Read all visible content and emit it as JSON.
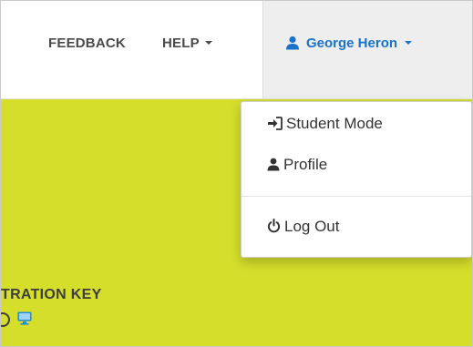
{
  "nav": {
    "feedback_label": "FEEDBACK",
    "help_label": "HELP",
    "user_name": "George Heron"
  },
  "user_dropdown": {
    "items": [
      {
        "label": "Student Mode",
        "icon": "sign-in-icon"
      },
      {
        "label": "Profile",
        "icon": "user-icon"
      },
      {
        "label": "Log Out",
        "icon": "power-icon"
      }
    ]
  },
  "main": {
    "registration_key_label": "TRATION KEY",
    "monitor_icon": "monitor-icon"
  },
  "colors": {
    "background": "#d5de2b",
    "accent": "#1a73c9",
    "navbar": "#ffffff",
    "user_menu_bg": "#eeeeee"
  }
}
